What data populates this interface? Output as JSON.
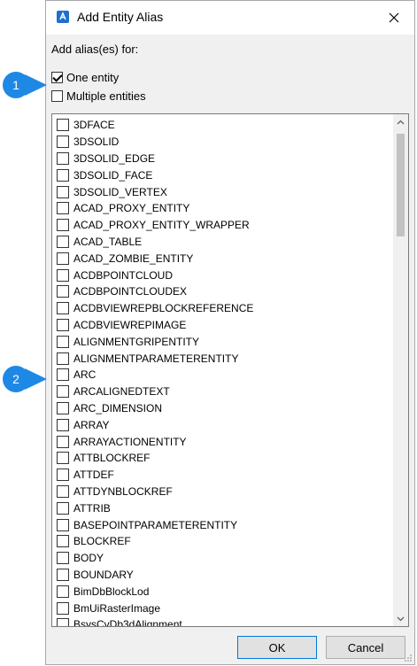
{
  "dialog": {
    "title": "Add Entity Alias",
    "section_label": "Add alias(es) for:",
    "options": [
      {
        "label": "One entity",
        "checked": true
      },
      {
        "label": "Multiple entities",
        "checked": false
      }
    ],
    "entities": [
      "3DFACE",
      "3DSOLID",
      "3DSOLID_EDGE",
      "3DSOLID_FACE",
      "3DSOLID_VERTEX",
      "ACAD_PROXY_ENTITY",
      "ACAD_PROXY_ENTITY_WRAPPER",
      "ACAD_TABLE",
      "ACAD_ZOMBIE_ENTITY",
      "ACDBPOINTCLOUD",
      "ACDBPOINTCLOUDEX",
      "ACDBVIEWREPBLOCKREFERENCE",
      "ACDBVIEWREPIMAGE",
      "ALIGNMENTGRIPENTITY",
      "ALIGNMENTPARAMETERENTITY",
      "ARC",
      "ARCALIGNEDTEXT",
      "ARC_DIMENSION",
      "ARRAY",
      "ARRAYACTIONENTITY",
      "ATTBLOCKREF",
      "ATTDEF",
      "ATTDYNBLOCKREF",
      "ATTRIB",
      "BASEPOINTPARAMETERENTITY",
      "BLOCKREF",
      "BODY",
      "BOUNDARY",
      "BimDbBlockLod",
      "BmUiRasterImage",
      "BsysCvDb3dAlignment"
    ],
    "ok_label": "OK",
    "cancel_label": "Cancel"
  },
  "callouts": [
    "1",
    "2"
  ],
  "colors": {
    "callout": "#1e88e5",
    "accent": "#1f6fd1"
  }
}
